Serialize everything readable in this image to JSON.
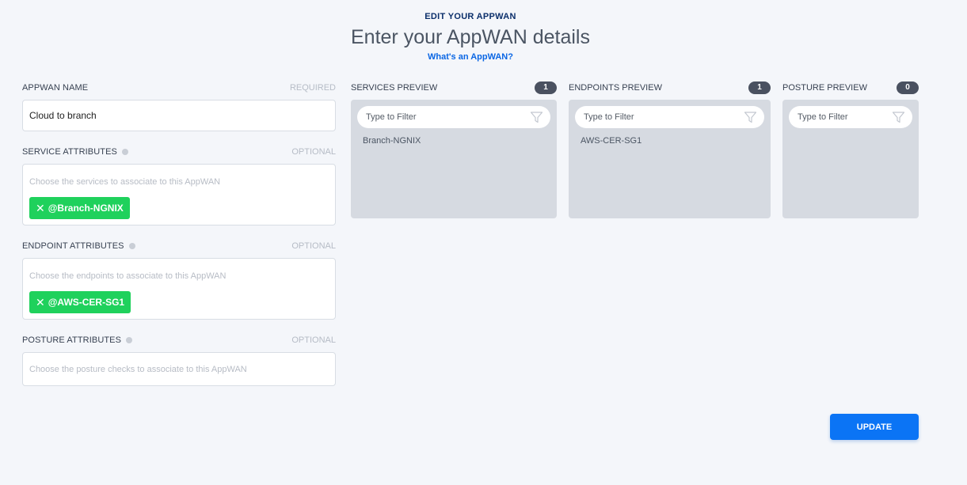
{
  "header": {
    "overline": "EDIT YOUR APPWAN",
    "title": "Enter your AppWAN details",
    "help_link": "What's an AppWAN?"
  },
  "form": {
    "name": {
      "label": "APPWAN NAME",
      "note": "REQUIRED",
      "value": "Cloud to branch"
    },
    "services": {
      "label": "SERVICE ATTRIBUTES",
      "note": "OPTIONAL",
      "placeholder": "Choose the services to associate to this AppWAN",
      "chips": [
        "@Branch-NGNIX"
      ]
    },
    "endpoints": {
      "label": "ENDPOINT ATTRIBUTES",
      "note": "OPTIONAL",
      "placeholder": "Choose the endpoints to associate to this AppWAN",
      "chips": [
        "@AWS-CER-SG1"
      ]
    },
    "posture": {
      "label": "POSTURE ATTRIBUTES",
      "note": "OPTIONAL",
      "placeholder": "Choose the posture checks to associate to this AppWAN"
    }
  },
  "previews": {
    "services": {
      "title": "SERVICES PREVIEW",
      "count": "1",
      "filter_placeholder": "Type to Filter",
      "items": [
        "Branch-NGNIX"
      ]
    },
    "endpoints": {
      "title": "ENDPOINTS PREVIEW",
      "count": "1",
      "filter_placeholder": "Type to Filter",
      "items": [
        "AWS-CER-SG1"
      ]
    },
    "posture": {
      "title": "POSTURE PREVIEW",
      "count": "0",
      "filter_placeholder": "Type to Filter",
      "items": []
    }
  },
  "actions": {
    "update_label": "UPDATE"
  },
  "colors": {
    "accent": "#0b74f5",
    "chip": "#1fd15c",
    "heading": "#0b2f6b"
  },
  "icons": {
    "chip_remove": "close-icon",
    "filter": "funnel-icon",
    "info": "info-icon"
  }
}
